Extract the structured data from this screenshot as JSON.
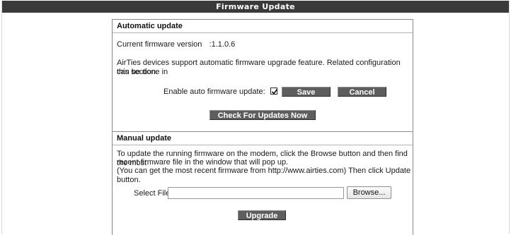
{
  "header": {
    "title": "Firmware Update"
  },
  "auto_update": {
    "title": "Automatic update",
    "current_version_label": "Current firmware version",
    "current_version_value": ":1.1.0.6",
    "description_line1": "AirTies devices support automatic firmware upgrade feature. Related configuration can be done in",
    "description_line2": "this section.",
    "enable_label": "Enable auto firmware update:",
    "enable_checked": true,
    "save_label": "Save",
    "cancel_label": "Cancel",
    "check_updates_label": "Check For Updates Now"
  },
  "manual_update": {
    "title": "Manual update",
    "instructions_line1": "To update the running firmware on the modem, click the Browse button and then find the most",
    "instructions_line2": "recent firmware file in the window that will pop up.",
    "instructions_line3": "(You can get the most recent firmware from http://www.airties.com) Then click Update button.",
    "select_file_label": "Select File:",
    "file_value": "",
    "browse_label": "Browse...",
    "upgrade_label": "Upgrade"
  },
  "colors": {
    "title_bar": "#3a3a3a",
    "button_bg": "#5e5e5e",
    "panel_border": "#8a8a8a"
  }
}
